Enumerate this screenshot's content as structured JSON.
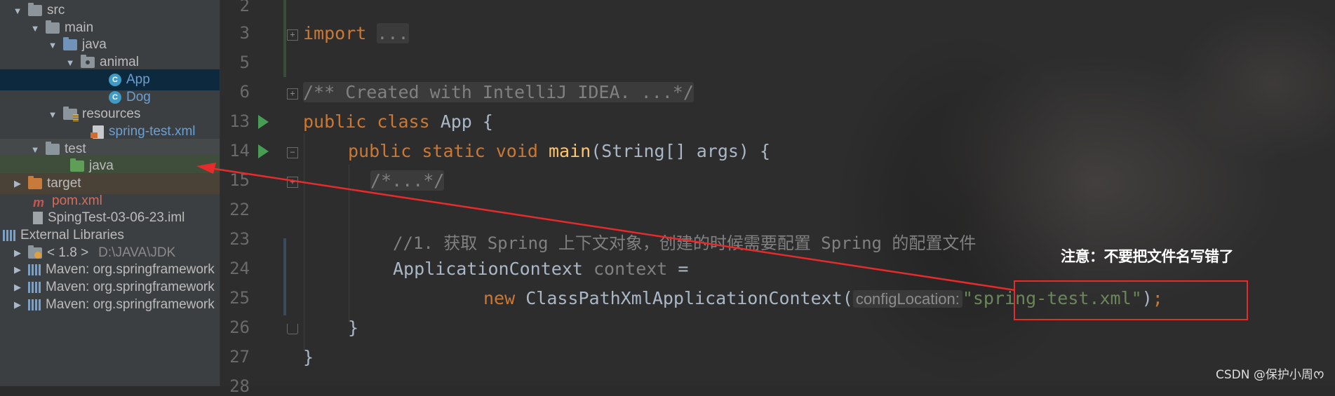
{
  "project_tree": {
    "items": [
      {
        "label": "src",
        "arrow": "▼",
        "icon": "folder-icon"
      },
      {
        "label": "main",
        "arrow": "▼",
        "icon": "folder-icon"
      },
      {
        "label": "java",
        "arrow": "▼",
        "icon": "source-folder-icon"
      },
      {
        "label": "animal",
        "arrow": "▼",
        "icon": "package-icon"
      },
      {
        "label": "App",
        "icon": "class-icon",
        "selected": true
      },
      {
        "label": "Dog",
        "icon": "class-icon"
      },
      {
        "label": "resources",
        "arrow": "▼",
        "icon": "resources-folder-icon"
      },
      {
        "label": "spring-test.xml",
        "icon": "xml-file-icon"
      },
      {
        "label": "test",
        "arrow": "▼",
        "icon": "folder-icon"
      },
      {
        "label": "java",
        "icon": "test-source-folder-icon"
      },
      {
        "label": "target",
        "arrow": "▶",
        "icon": "excluded-folder-icon"
      },
      {
        "label": "pom.xml",
        "icon": "maven-icon"
      },
      {
        "label": "SpingTest-03-06-23.iml",
        "icon": "iml-file-icon"
      },
      {
        "label": "External Libraries",
        "arrow": "▼",
        "icon": "libraries-icon"
      },
      {
        "label": "< 1.8 >",
        "secondary": "D:\\JAVA\\JDK",
        "arrow": "▶",
        "icon": "jdk-icon"
      },
      {
        "label": "Maven: org.springframework",
        "arrow": "▶",
        "icon": "library-icon"
      },
      {
        "label": "Maven: org.springframework",
        "arrow": "▶",
        "icon": "library-icon"
      },
      {
        "label": "Maven: org.springframework",
        "arrow": "▶",
        "icon": "library-icon"
      }
    ]
  },
  "editor": {
    "line_numbers": [
      "2",
      "3",
      "5",
      "6",
      "13",
      "14",
      "15",
      "22",
      "23",
      "24",
      "25",
      "26",
      "27",
      "28"
    ],
    "code": {
      "import_kw": "import",
      "import_fold": "...",
      "doc_comment": "/** Created with IntelliJ IDEA. ...*/",
      "public_kw": "public",
      "class_kw": "class",
      "class_name": "App {",
      "public_static_void": "public static void",
      "main_fn": "main",
      "main_params": "(String[] args) {",
      "folded_comment": "/*...*/",
      "line_comment": "//1. 获取 Spring 上下文对象，创建的时候需要配置 Spring 的配置文件",
      "ctx_type": "ApplicationContext",
      "ctx_var": "context",
      "assign": " =",
      "new_kw": "new",
      "ctor": "ClassPathXmlApplicationContext(",
      "param_hint": "configLocation:",
      "xml_string": "\"spring-test.xml\"",
      "close_paren": ")",
      "semicolon": ";",
      "close_brace_method": "}",
      "close_brace_class": "}"
    }
  },
  "annotation": {
    "note": "注意：不要把文件名写错了",
    "color": "#e52b2b"
  },
  "watermark": "CSDN @保护小周ᰔ",
  "colors": {
    "keyword": "#cc7832",
    "string": "#6a8759",
    "comment": "#808080",
    "function": "#ffc66d",
    "text": "#a9b7c6",
    "selection": "#0d293e"
  }
}
